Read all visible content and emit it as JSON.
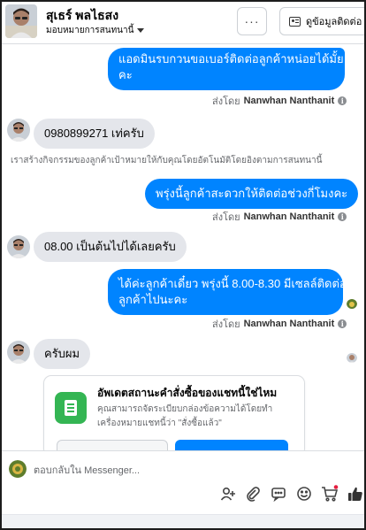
{
  "header": {
    "name": "สุเธร์ พลไธสง",
    "assignment": "มอบหมายการสนทนานี้",
    "more_label": "···",
    "contact_label": "ดูข้อมูลติดต่อ"
  },
  "messages": {
    "out1": {
      "line1": "แอดมินรบกวนขอเบอร์ติดต่อลูกค้าหน่อยได้มั้ย",
      "line2": "คะ",
      "sent_by_prefix": "ส่งโดย",
      "agent": "Nanwhan Nanthanit"
    },
    "in1": "0980899271 เท่ครับ",
    "system_note": "เราสร้างกิจกรรมของลูกค้าเป้าหมายให้กับคุณโดยอัตโนมัติโดยอิงตามการสนทนานี้",
    "out2": {
      "text": "พรุ่งนี้ลูกค้าสะดวกให้ติดต่อช่วงกี่โมงคะ",
      "sent_by_prefix": "ส่งโดย",
      "agent": "Nanwhan Nanthanit"
    },
    "in2": "08.00 เป็นต้นไปได้เลยครับ",
    "out3": {
      "line1": "ได้ค่ะลูกค้าเดี๋ยว พรุ่งนี้ 8.00-8.30 มีเซลล์ติดต่อ",
      "line2": "ลูกค้าไปนะคะ",
      "sent_by_prefix": "ส่งโดย",
      "agent": "Nanwhan Nanthanit"
    },
    "in3": "ครับผม"
  },
  "card": {
    "title": "อัพเดตสถานะคำสั่งซื้อของแชทนี้ใช่ไหม",
    "body_line1": "คุณสามารถจัดระเบียบกล่องข้อความได้โดยทำ",
    "body_line2": "เครื่องหมายแชทนี้ว่า \"สั่งซื้อแล้ว\""
  },
  "composer": {
    "placeholder": "ตอบกลับใน Messenger..."
  },
  "icons": {
    "add_person": "add-person-icon",
    "attach": "paperclip-icon",
    "chat": "speech-bubble-icon",
    "emoji": "smiley-icon",
    "cart": "shopping-cart-icon",
    "like": "thumbs-up-icon",
    "info": "info-icon",
    "dropdown": "dropdown-caret-icon"
  },
  "colors": {
    "outgoing_bubble": "#0084ff",
    "incoming_bubble": "#e4e6eb",
    "card_icon": "#34b553",
    "meta_text": "#65676b"
  }
}
